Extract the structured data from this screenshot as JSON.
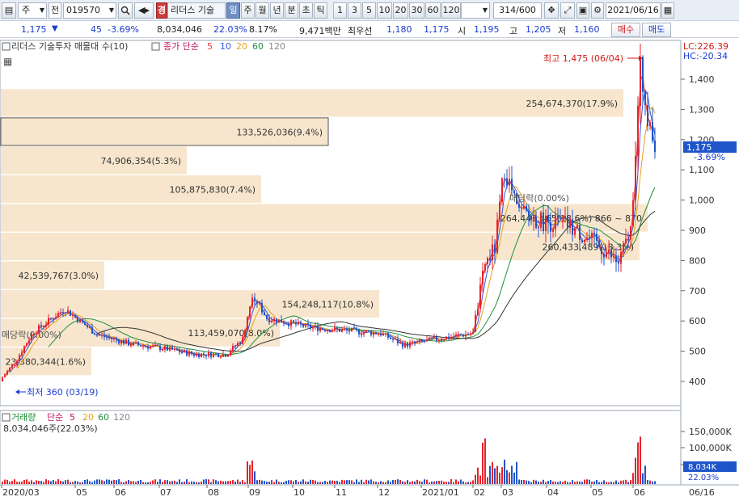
{
  "toolbar": {
    "menu_glyph": "▤",
    "market": "주",
    "mode": "전",
    "code": "019570",
    "stock_name": "리더스 기술",
    "brand_glyph": "경",
    "periods": [
      "일",
      "주",
      "월",
      "년",
      "분",
      "초",
      "틱"
    ],
    "active_period": "일",
    "intervals": [
      "1",
      "3",
      "5",
      "10",
      "20",
      "30",
      "60",
      "120"
    ],
    "page_count": "314/600",
    "date": "2021/06/16"
  },
  "quote": {
    "price": "1,175",
    "direction_glyph": "▼",
    "change": "45",
    "change_pct": "-3.69%",
    "volume": "8,034,046",
    "volume_pct": "22.03%",
    "turnover_pct": "8.17%",
    "amount": "9,471백만",
    "best_label": "최우선",
    "best_ask": "1,180",
    "best_bid": "1,175",
    "open_label": "시",
    "open": "1,195",
    "high_label": "고",
    "high": "1,205",
    "low_label": "저",
    "low": "1,160",
    "buy_label": "매수",
    "sell_label": "매도"
  },
  "price_panel": {
    "legend_title": "리더스 기술투자 매물대 수(10)",
    "ma_label": "종가 단순",
    "ma_periods": [
      "5",
      "10",
      "20",
      "60",
      "120"
    ],
    "lc_label": "LC:226.39",
    "hc_label": "HC:-20.34",
    "high_marker": "최고 1,475 (06/04)",
    "low_marker": "최저 360 (03/19)",
    "current_price": "1,175",
    "current_pct": "-3.69%",
    "axis_ticks": [
      "1,400",
      "1,300",
      "1,200",
      "1,100",
      "1,000",
      "900",
      "800",
      "700",
      "600",
      "500",
      "400"
    ],
    "volume_profile": [
      {
        "label": "254,674,370(17.9%)",
        "price": 1320
      },
      {
        "label": "133,526,036(9.4%)",
        "price": 1225
      },
      {
        "label": "74,906,354(5.3%)",
        "price": 1130
      },
      {
        "label": "105,875,830(7.4%)",
        "price": 1035
      },
      {
        "label": "264,443,465(18.6%) 866 ~ 870",
        "price": 940
      },
      {
        "label": "260,433,489(18.3%)",
        "price": 845
      },
      {
        "label": "42,539,767(3.0%)",
        "price": 750
      },
      {
        "label": "154,248,117(10.8%)",
        "price": 655
      },
      {
        "label": "113,459,070(8.0%)",
        "price": 560
      },
      {
        "label": "23,380,344(1.6%)",
        "price": 465
      }
    ],
    "annotation_1": "매당락(0.00%)",
    "annotation_2": "매당락(0.00%)"
  },
  "volume_panel": {
    "legend_title": "거래량",
    "ma_label": "단순",
    "ma_periods": [
      "5",
      "20",
      "60",
      "120"
    ],
    "volume_text": "8,034,046주(22.03%)",
    "axis_ticks": [
      "150,000K",
      "100,000K",
      "50,000K"
    ],
    "current_volume": "8,034K",
    "current_pct": "22.03%"
  },
  "x_axis": {
    "labels": [
      "2020/03",
      "05",
      "06",
      "07",
      "08",
      "09",
      "10",
      "11",
      "12",
      "2021/01",
      "02",
      "03",
      "04",
      "05",
      "06"
    ],
    "current_date": "06/16"
  },
  "colors": {
    "up": "#e8232b",
    "down": "#1f55c9",
    "ma5": "#e23a3a",
    "ma10": "#3355dd",
    "ma20": "#e1a21f",
    "ma60": "#1e8f3a",
    "ma120": "#333333",
    "profile_fill": "#f7e6cd"
  }
}
